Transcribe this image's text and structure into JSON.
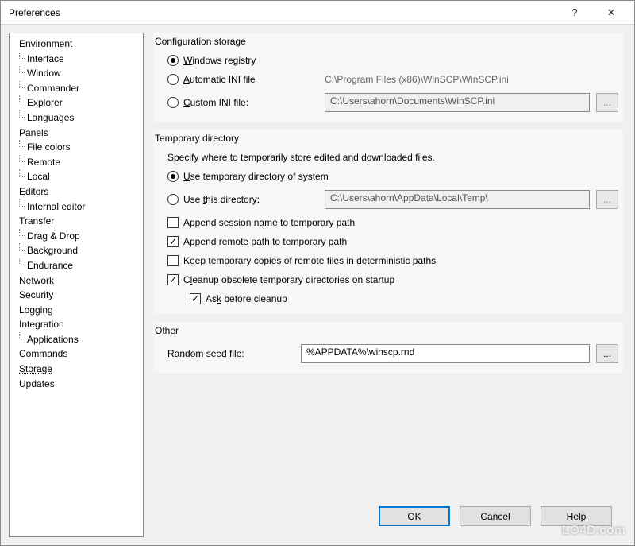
{
  "window": {
    "title": "Preferences"
  },
  "tree": {
    "items": [
      {
        "label": "Environment",
        "level": 0
      },
      {
        "label": "Interface",
        "level": 1
      },
      {
        "label": "Window",
        "level": 1
      },
      {
        "label": "Commander",
        "level": 1
      },
      {
        "label": "Explorer",
        "level": 1
      },
      {
        "label": "Languages",
        "level": 1
      },
      {
        "label": "Panels",
        "level": 0
      },
      {
        "label": "File colors",
        "level": 1
      },
      {
        "label": "Remote",
        "level": 1
      },
      {
        "label": "Local",
        "level": 1
      },
      {
        "label": "Editors",
        "level": 0
      },
      {
        "label": "Internal editor",
        "level": 1
      },
      {
        "label": "Transfer",
        "level": 0
      },
      {
        "label": "Drag & Drop",
        "level": 1
      },
      {
        "label": "Background",
        "level": 1
      },
      {
        "label": "Endurance",
        "level": 1
      },
      {
        "label": "Network",
        "level": 0
      },
      {
        "label": "Security",
        "level": 0
      },
      {
        "label": "Logging",
        "level": 0
      },
      {
        "label": "Integration",
        "level": 0
      },
      {
        "label": "Applications",
        "level": 1
      },
      {
        "label": "Commands",
        "level": 0
      },
      {
        "label": "Storage",
        "level": 0,
        "selected": true
      },
      {
        "label": "Updates",
        "level": 0
      }
    ]
  },
  "config_storage": {
    "title": "Configuration storage",
    "opt_registry": "Windows registry",
    "opt_auto_ini": "Automatic INI file",
    "opt_custom_ini": "Custom INI file:",
    "auto_ini_path": "C:\\Program Files (x86)\\WinSCP\\WinSCP.ini",
    "custom_ini_path": "C:\\Users\\ahorn\\Documents\\WinSCP.ini",
    "browse": "..."
  },
  "temp_dir": {
    "title": "Temporary directory",
    "desc": "Specify where to temporarily store edited and downloaded files.",
    "opt_system": "Use temporary directory of system",
    "opt_custom": "Use this directory:",
    "custom_path": "C:\\Users\\ahorn\\AppData\\Local\\Temp\\",
    "browse": "...",
    "cb_append_session": "Append session name to temporary path",
    "cb_append_remote": "Append remote path to temporary path",
    "cb_keep_copies": "Keep temporary copies of remote files in deterministic paths",
    "cb_cleanup": "Cleanup obsolete temporary directories on startup",
    "cb_ask_cleanup": "Ask before cleanup"
  },
  "other": {
    "title": "Other",
    "seed_label": "Random seed file:",
    "seed_path": "%APPDATA%\\winscp.rnd",
    "browse": "..."
  },
  "buttons": {
    "ok": "OK",
    "cancel": "Cancel",
    "help": "Help"
  },
  "watermark": "LO4D.com"
}
